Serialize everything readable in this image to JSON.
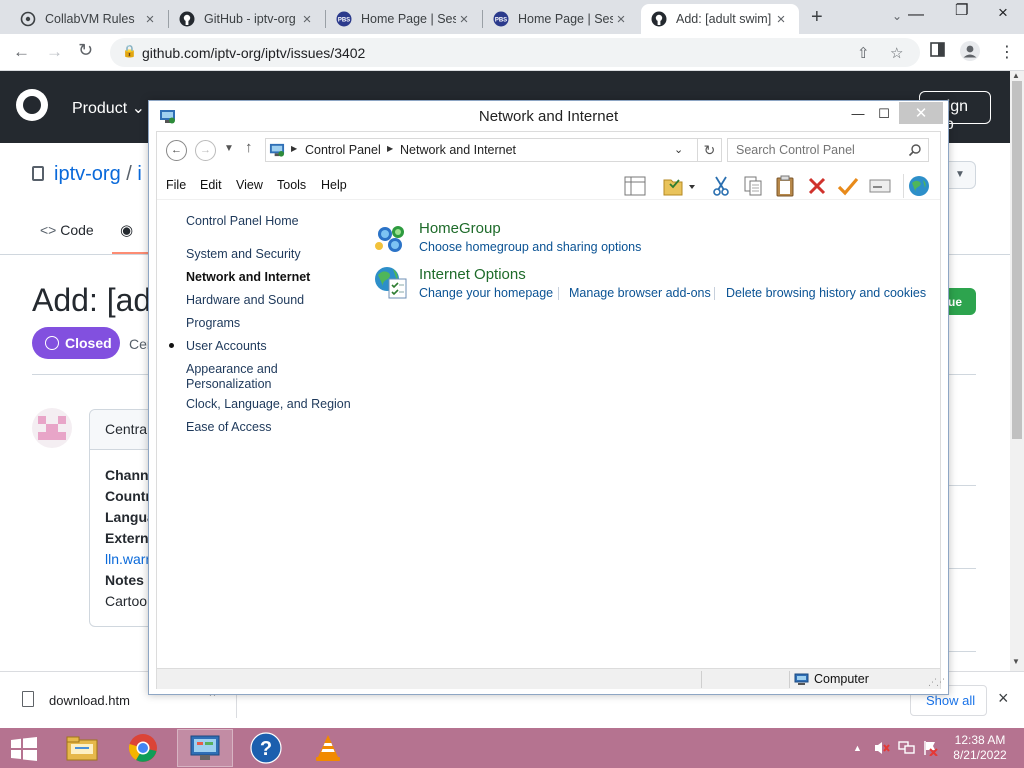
{
  "browser": {
    "tabs": [
      {
        "title": "CollabVM Rules",
        "icon": "collabvm-icon"
      },
      {
        "title": "GitHub - iptv-org",
        "icon": "github-icon"
      },
      {
        "title": "Home Page | Sesa",
        "icon": "pbs-kids-icon"
      },
      {
        "title": "Home Page | Sesa",
        "icon": "pbs-kids-icon"
      },
      {
        "title": "Add: [adult swim]",
        "icon": "github-icon",
        "active": true
      }
    ],
    "url": "github.com/iptv-org/iptv/issues/3402"
  },
  "github": {
    "nav_product": "Product",
    "sign_up": "Sign up",
    "repo_owner": "iptv-org",
    "repo_slash": "/",
    "repo_name_partial": "i",
    "tab_code": "Code",
    "issue_title_partial": "Add: [ad",
    "state_label": "Closed",
    "state_meta_partial": "Cer",
    "green_button_partial": "ue",
    "comment_header_partial": "Centra",
    "comment_lines": [
      "Channe",
      "Countr",
      "Langua",
      "Externa",
      "lln.warr",
      "Notes",
      "Cartoo"
    ]
  },
  "downloads": {
    "file": "download.htm",
    "show_all": "Show all"
  },
  "window": {
    "title": "Network and Internet",
    "breadcrumb": [
      "Control Panel",
      "Network and Internet"
    ],
    "search_placeholder": "Search Control Panel",
    "menu": [
      "File",
      "Edit",
      "View",
      "Tools",
      "Help"
    ],
    "nav": {
      "home": "Control Panel Home",
      "items": [
        "System and Security",
        "Network and Internet",
        "Hardware and Sound",
        "Programs",
        "User Accounts",
        "Appearance and Personalization",
        "Clock, Language, and Region",
        "Ease of Access"
      ],
      "current_index": 1
    },
    "categories": [
      {
        "title": "HomeGroup",
        "links": [
          "Choose homegroup and sharing options"
        ]
      },
      {
        "title": "Internet Options",
        "links": [
          "Change your homepage",
          "Manage browser add-ons",
          "Delete browsing history and cookies"
        ]
      }
    ],
    "status": "Computer"
  },
  "taskbar": {
    "time": "12:38 AM",
    "date": "8/21/2022",
    "background": "#b57390"
  }
}
